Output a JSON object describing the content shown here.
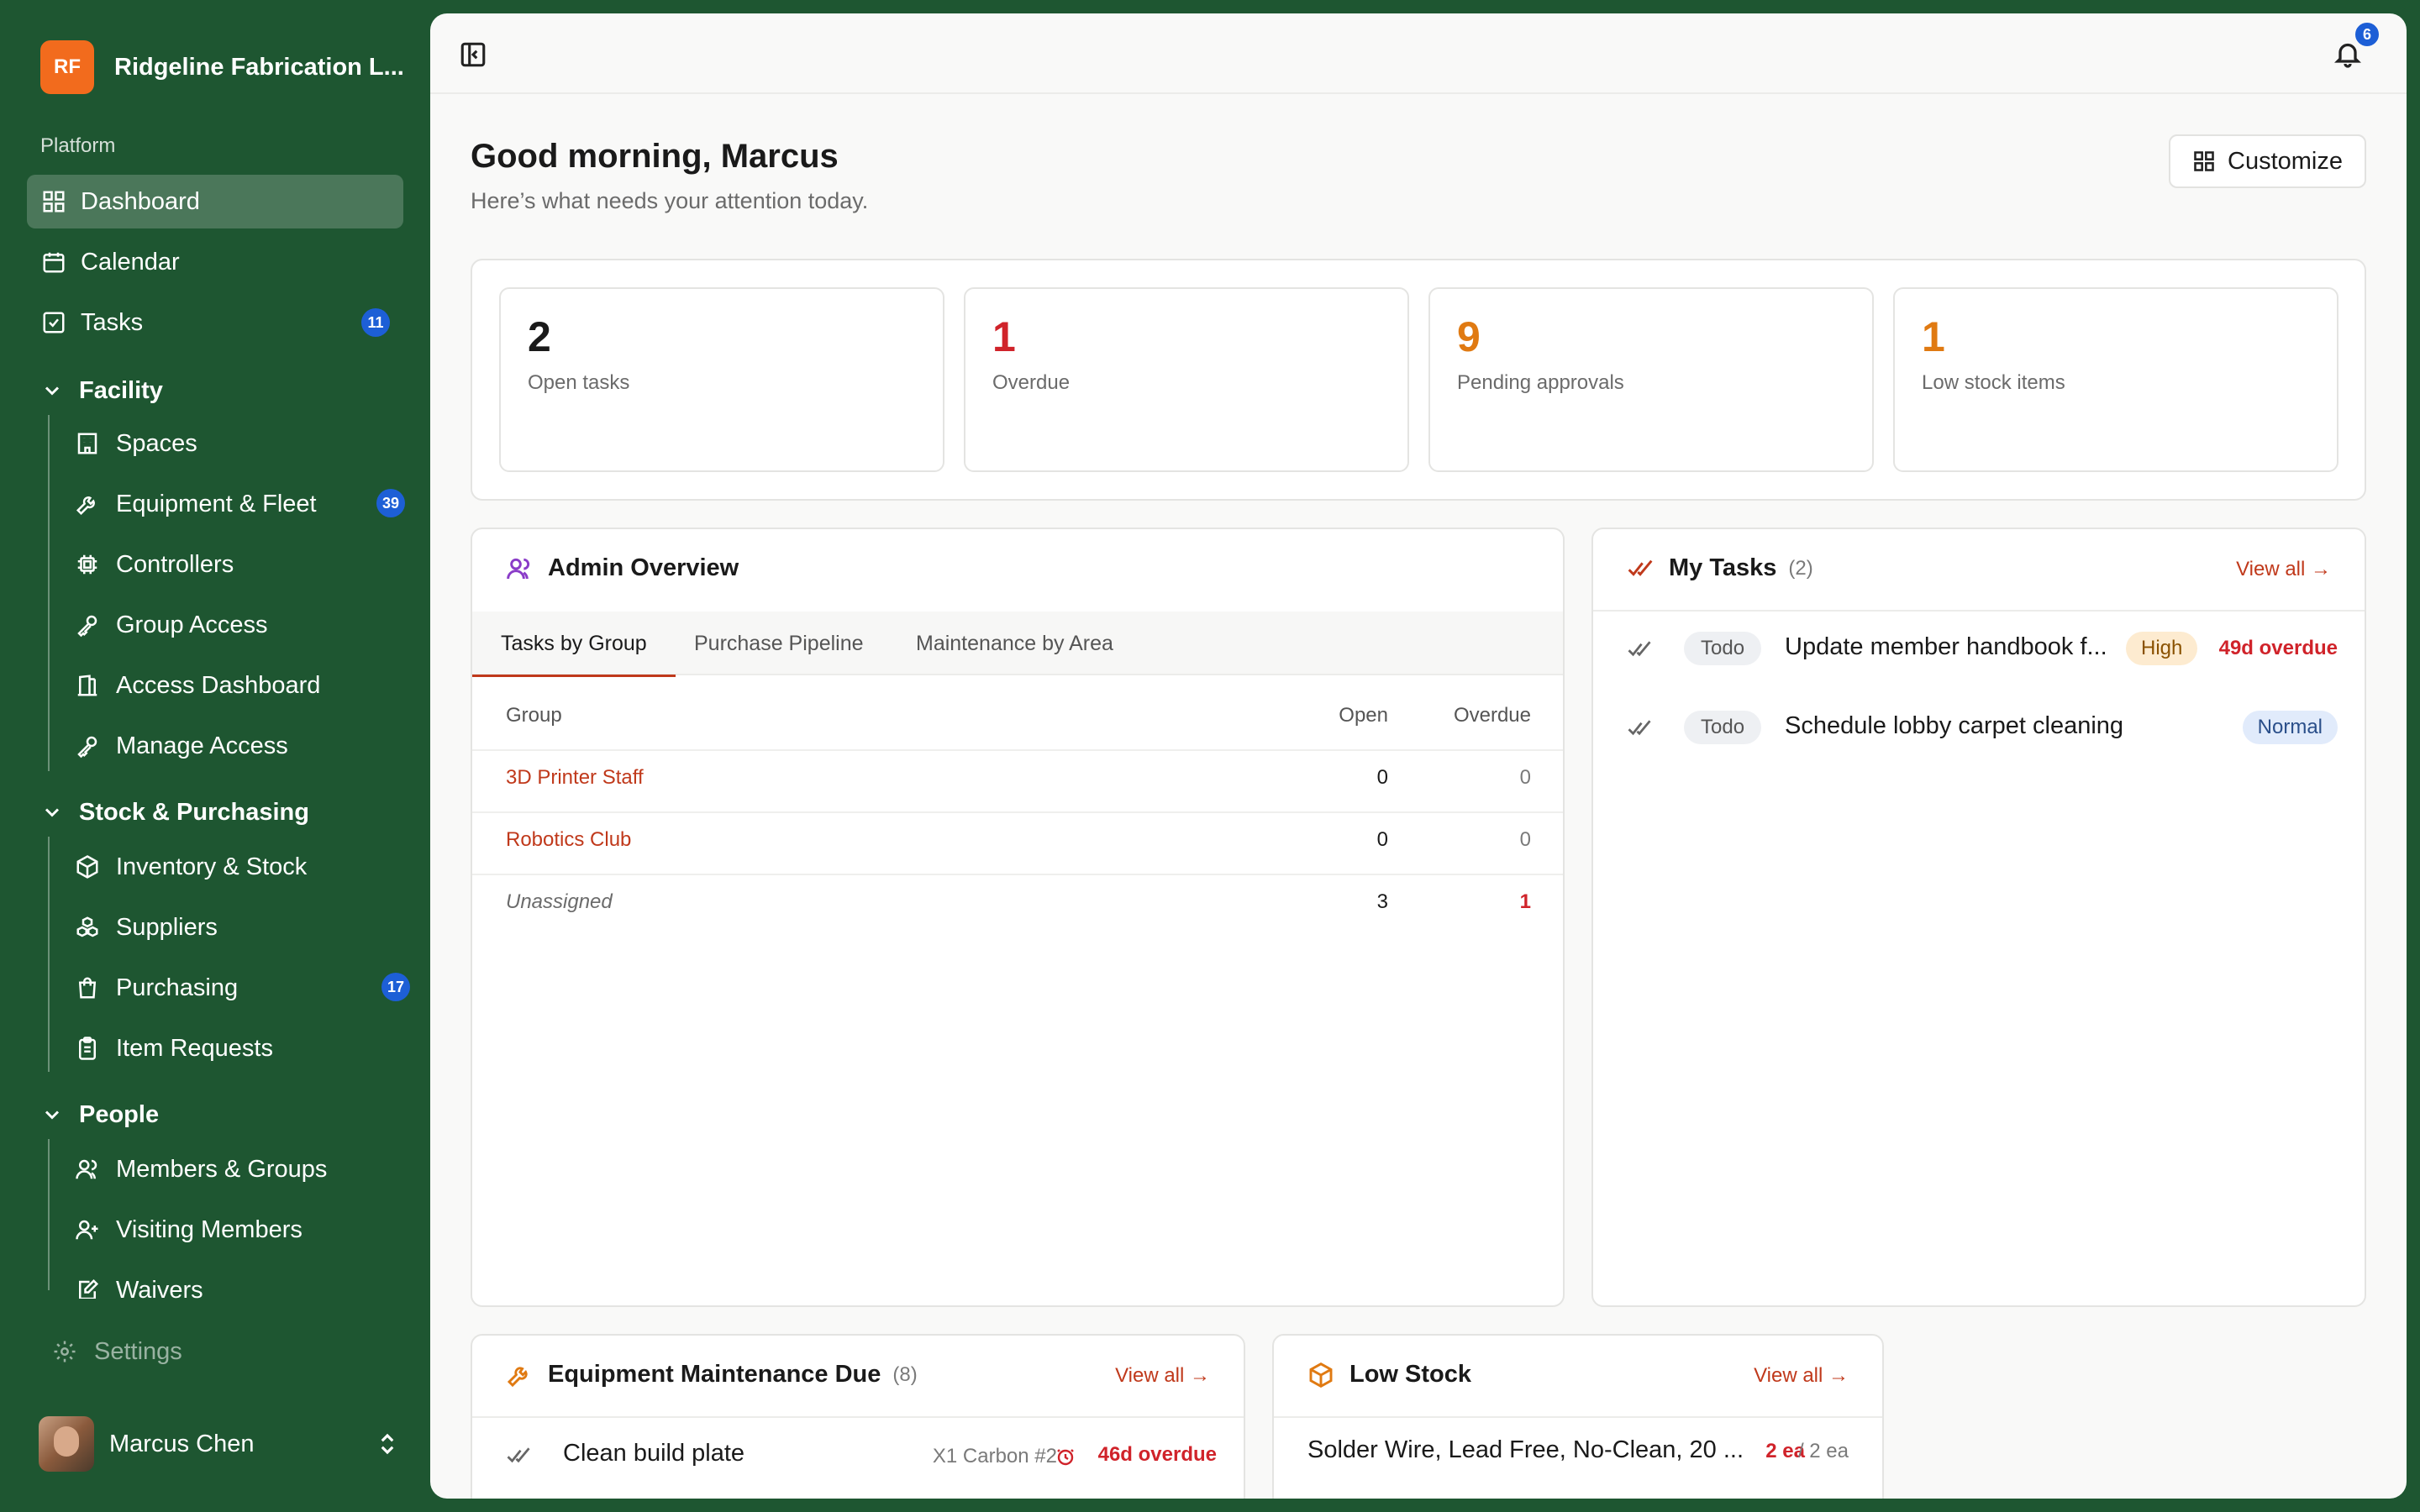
{
  "org": {
    "logo_text": "RF",
    "name": "Ridgeline Fabrication L..."
  },
  "sidebar": {
    "section_label": "Platform",
    "items": [
      {
        "label": "Dashboard",
        "icon": "grid-icon",
        "active": true
      },
      {
        "label": "Calendar",
        "icon": "calendar-icon"
      },
      {
        "label": "Tasks",
        "icon": "checkbox-icon",
        "badge": "11"
      }
    ],
    "groups": [
      {
        "label": "Facility",
        "items": [
          {
            "label": "Spaces",
            "icon": "building-icon"
          },
          {
            "label": "Equipment & Fleet",
            "icon": "wrench-icon",
            "badge": "39"
          },
          {
            "label": "Controllers",
            "icon": "chip-icon"
          },
          {
            "label": "Group Access",
            "icon": "key-icon"
          },
          {
            "label": "Access Dashboard",
            "icon": "door-icon"
          },
          {
            "label": "Manage Access",
            "icon": "key-icon"
          }
        ]
      },
      {
        "label": "Stock & Purchasing",
        "items": [
          {
            "label": "Inventory & Stock",
            "icon": "box-icon"
          },
          {
            "label": "Suppliers",
            "icon": "boxes-icon"
          },
          {
            "label": "Purchasing",
            "icon": "bag-icon",
            "badge": "17"
          },
          {
            "label": "Item Requests",
            "icon": "clipboard-icon"
          }
        ]
      },
      {
        "label": "People",
        "items": [
          {
            "label": "Members & Groups",
            "icon": "users-icon"
          },
          {
            "label": "Visiting Members",
            "icon": "user-plus-icon"
          },
          {
            "label": "Waivers",
            "icon": "pen-icon"
          }
        ]
      }
    ],
    "settings_label": "Settings",
    "user_name": "Marcus Chen"
  },
  "header": {
    "notifications_count": "6"
  },
  "greeting": {
    "title": "Good morning, Marcus",
    "subtitle": "Here’s what needs your attention today.",
    "customize_label": "Customize"
  },
  "stats": [
    {
      "value": "2",
      "label": "Open tasks",
      "color": "#1a1a1a"
    },
    {
      "value": "1",
      "label": "Overdue",
      "color": "#d0232a"
    },
    {
      "value": "9",
      "label": "Pending approvals",
      "color": "#e07a12"
    },
    {
      "value": "1",
      "label": "Low stock items",
      "color": "#e07a12"
    }
  ],
  "admin_overview": {
    "title": "Admin Overview",
    "tabs": [
      "Tasks by Group",
      "Purchase Pipeline",
      "Maintenance by Area"
    ],
    "columns": [
      "Group",
      "Open",
      "Overdue"
    ],
    "rows": [
      {
        "group": "3D Printer Staff",
        "open": "0",
        "overdue": "0"
      },
      {
        "group": "Robotics Club",
        "open": "0",
        "overdue": "0"
      },
      {
        "group": "Unassigned",
        "open": "3",
        "overdue": "1"
      }
    ]
  },
  "my_tasks": {
    "title": "My Tasks",
    "count": "(2)",
    "view_all": "View all →",
    "items": [
      {
        "status": "Todo",
        "title": "Update member handbook f...",
        "priority": "High",
        "overdue": "49d overdue"
      },
      {
        "status": "Todo",
        "title": "Schedule lobby carpet cleaning",
        "priority": "Normal"
      }
    ]
  },
  "equipment": {
    "title": "Equipment Maintenance Due",
    "count": "(8)",
    "view_all": "View all →",
    "items": [
      {
        "title": "Clean build plate",
        "equipment": "X1 Carbon #2",
        "overdue": "46d overdue"
      }
    ]
  },
  "low_stock": {
    "title": "Low Stock",
    "view_all": "View all →",
    "items": [
      {
        "title": "Solder Wire, Lead Free, No-Clean, 20 ...",
        "qty": "2 ea",
        "min": "/ 2 ea"
      }
    ]
  },
  "colors": {
    "brand_green": "#1e5631",
    "accent_red": "#c0391b",
    "badge_blue": "#1d5fd6",
    "org_orange": "#f26b1d"
  }
}
